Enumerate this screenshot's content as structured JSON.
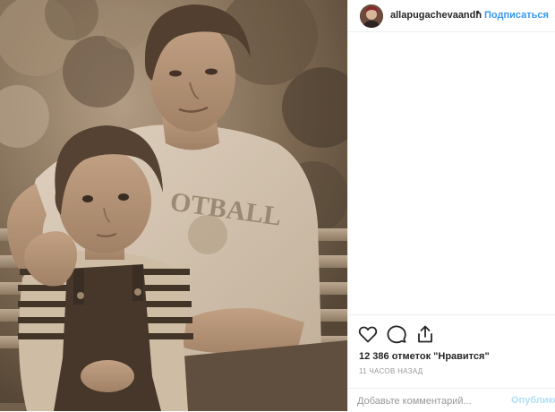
{
  "post": {
    "username": "allapugachevaandh",
    "separator": "•",
    "follow_label": "Подписаться",
    "likes_text": "12 386 отметок \"Нравится\"",
    "time_text": "11 ЧАСОВ НАЗАД",
    "comment_placeholder": "Добавьте комментарий...",
    "publish_label": "Опубликовать"
  },
  "icons": {
    "like": "heart-icon",
    "comment": "comment-icon",
    "share": "share-icon"
  },
  "colors": {
    "link_blue": "#3897f0",
    "disabled_blue": "#b2dffc",
    "text_dark": "#262626",
    "text_muted": "#999999",
    "divider": "#efefef"
  },
  "photo": {
    "shirt_text": "OTBALL"
  }
}
